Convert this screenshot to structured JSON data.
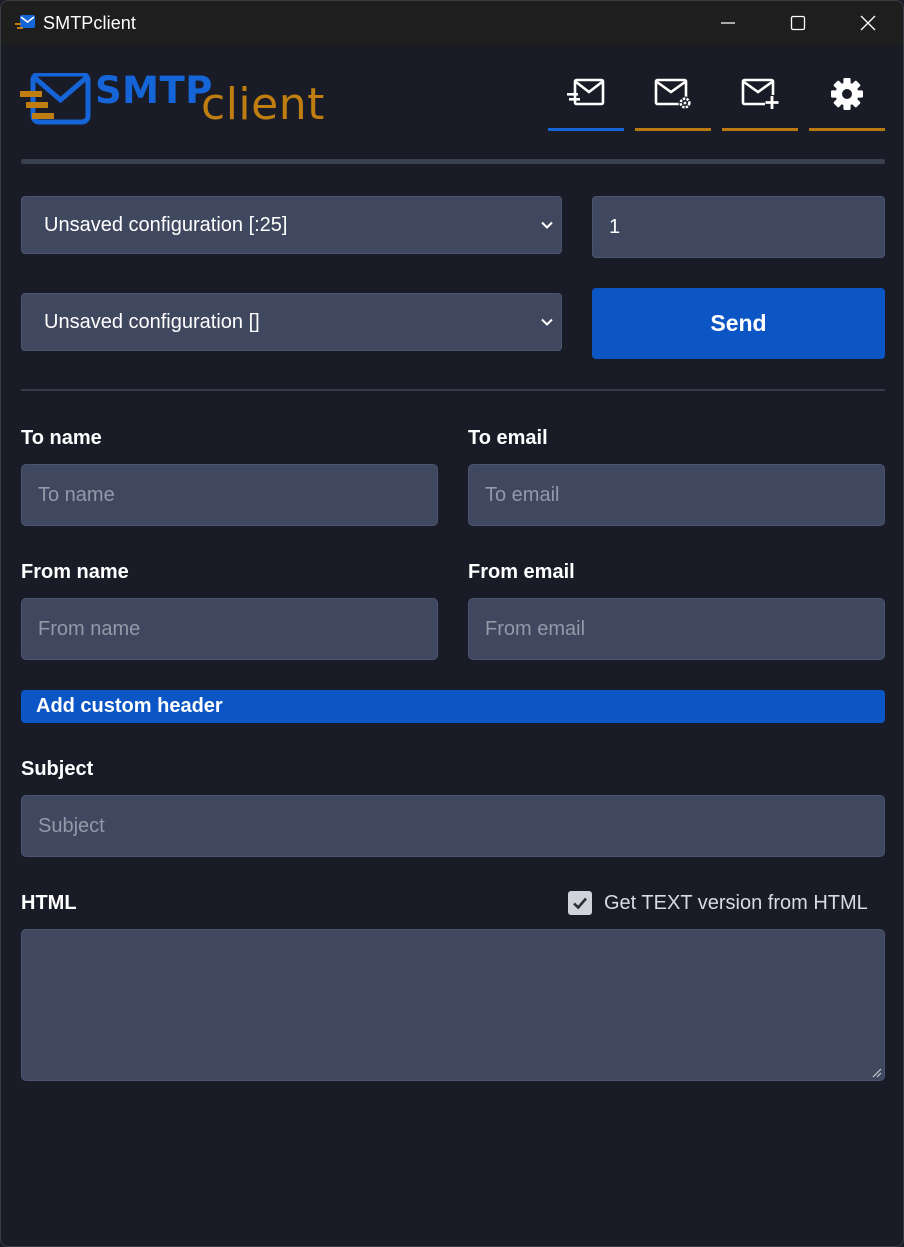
{
  "window": {
    "title": "SMTPclient",
    "controls": [
      "minimize-icon",
      "maximize-icon",
      "close-icon"
    ]
  },
  "logo": {
    "part1": "SMTP",
    "part2": "client"
  },
  "nav": {
    "items": [
      {
        "name": "send-mail",
        "icon": "mail-send-icon",
        "active": true
      },
      {
        "name": "mail-settings",
        "icon": "mail-gear-icon",
        "active": false
      },
      {
        "name": "new-mail",
        "icon": "mail-plus-icon",
        "active": false
      },
      {
        "name": "settings",
        "icon": "gear-icon",
        "active": false
      }
    ]
  },
  "config": {
    "server_select": "Unsaved configuration [:25]",
    "message_select": "Unsaved configuration []",
    "count": "1",
    "send_label": "Send"
  },
  "form": {
    "to_name_label": "To name",
    "to_name_placeholder": "To name",
    "to_email_label": "To email",
    "to_email_placeholder": "To email",
    "from_name_label": "From name",
    "from_name_placeholder": "From name",
    "from_email_label": "From email",
    "from_email_placeholder": "From email",
    "custom_header_label": "Add custom header",
    "subject_label": "Subject",
    "subject_placeholder": "Subject",
    "html_label": "HTML",
    "text_from_html_label": "Get TEXT version from HTML",
    "text_from_html_checked": true,
    "html_value": ""
  },
  "colors": {
    "accent_blue": "#0b56c4",
    "accent_orange": "#c07d10",
    "background": "#191c26",
    "input_bg": "#3f485f"
  }
}
